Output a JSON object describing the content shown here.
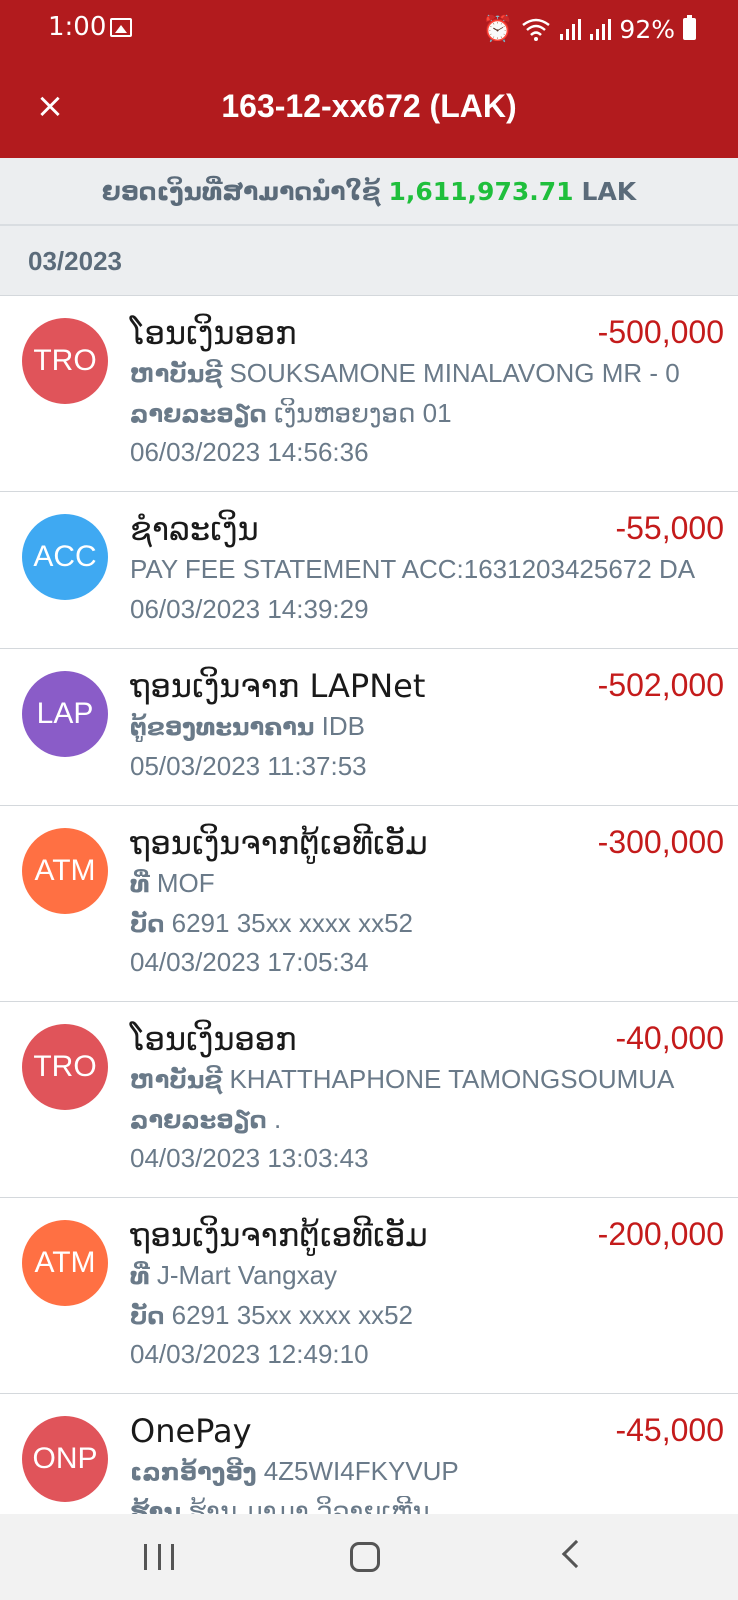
{
  "status_bar": {
    "time": "1:00",
    "battery": "92%",
    "icons": [
      "image-icon",
      "alarm-icon",
      "wifi-icon",
      "signal-icon",
      "signal-icon",
      "battery-icon"
    ]
  },
  "header": {
    "title": "163-12-xx672 (LAK)",
    "close_icon": "×"
  },
  "balance": {
    "label": "ຍອດເງິນທີ່ສາມາດນຳໃຊ້",
    "amount": "1,611,973.71",
    "currency": "LAK"
  },
  "month": "03/2023",
  "colors": {
    "brand_red": "#b21b1e",
    "amount_red": "#c41b1b",
    "balance_green": "#1fbf3c"
  },
  "transactions": [
    {
      "badge": "TRO",
      "badge_color": "#e0545a",
      "title": "ໂອນເງິນອອກ",
      "amount": "-500,000",
      "lines": [
        {
          "label": "ຫາບັນຊີ",
          "value": "SOUKSAMONE MINALAVONG MR - 0"
        },
        {
          "label": "ລາຍລະອຽດ",
          "value": "ເງິນຫອຍງອດ 01"
        },
        {
          "label": "",
          "value": "06/03/2023 14:56:36"
        }
      ]
    },
    {
      "badge": "ACC",
      "badge_color": "#3fa9f2",
      "title": "ຊຳລະເງິນ",
      "amount": "-55,000",
      "lines": [
        {
          "label": "",
          "value": "PAY FEE STATEMENT ACC:1631203425672 DA"
        },
        {
          "label": "",
          "value": "06/03/2023 14:39:29"
        }
      ]
    },
    {
      "badge": "LAP",
      "badge_color": "#8a5cc8",
      "title": "ຖອນເງິນຈາກ LAPNet",
      "amount": "-502,000",
      "lines": [
        {
          "label": "ຕູ້ຂອງທະນາຄານ",
          "value": "IDB"
        },
        {
          "label": "",
          "value": "05/03/2023 11:37:53"
        }
      ]
    },
    {
      "badge": "ATM",
      "badge_color": "#ff7043",
      "title": "ຖອນເງິນຈາກຕູ້ເອທີເອັມ",
      "amount": "-300,000",
      "lines": [
        {
          "label": "ທີ່",
          "value": "MOF"
        },
        {
          "label": "ບັດ",
          "value": "6291 35xx xxxx xx52"
        },
        {
          "label": "",
          "value": "04/03/2023 17:05:34"
        }
      ]
    },
    {
      "badge": "TRO",
      "badge_color": "#e0545a",
      "title": "ໂອນເງິນອອກ",
      "amount": "-40,000",
      "lines": [
        {
          "label": "ຫາບັນຊີ",
          "value": "KHATTHAPHONE TAMONGSOUMUA"
        },
        {
          "label": "ລາຍລະອຽດ",
          "value": "."
        },
        {
          "label": "",
          "value": "04/03/2023 13:03:43"
        }
      ]
    },
    {
      "badge": "ATM",
      "badge_color": "#ff7043",
      "title": "ຖອນເງິນຈາກຕູ້ເອທີເອັມ",
      "amount": "-200,000",
      "lines": [
        {
          "label": "ທີ່",
          "value": "J-Mart Vangxay"
        },
        {
          "label": "ບັດ",
          "value": "6291 35xx xxxx xx52"
        },
        {
          "label": "",
          "value": "04/03/2023 12:49:10"
        }
      ]
    },
    {
      "badge": "ONP",
      "badge_color": "#e0545a",
      "title": "OnePay",
      "amount": "-45,000",
      "lines": [
        {
          "label": "ເລກອ້າງອີງ",
          "value": "4Z5WI4FKYVUP"
        },
        {
          "label": "ຮ້ານ",
          "value": "ຮ້ານ ມາມາ ວິລາຍເຫີນ"
        }
      ]
    }
  ]
}
